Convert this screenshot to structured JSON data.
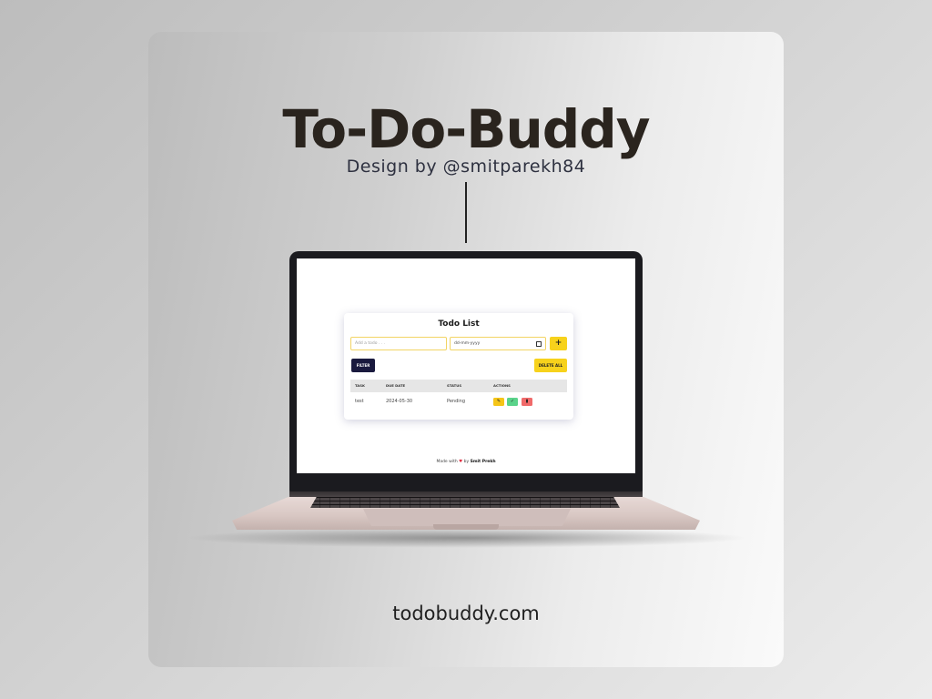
{
  "poster": {
    "title": "To-Do-Buddy",
    "subtitle": "Design by @smitparekh84",
    "domain": "todobuddy.com"
  },
  "app": {
    "title": "Todo List",
    "task_placeholder": "Add a todo . . .",
    "date_placeholder": "dd-mm-yyyy",
    "add_label": "+",
    "filter_label": "FILTER",
    "delete_all_label": "DELETE ALL",
    "table": {
      "headers": [
        "TASK",
        "DUE DATE",
        "STATUS",
        "ACTIONS"
      ],
      "rows": [
        {
          "task": "test",
          "due_date": "2024-05-30",
          "status": "Pending"
        }
      ]
    },
    "footer": {
      "prefix": "Made with",
      "by": "by",
      "author": "Smit Prekh"
    }
  },
  "colors": {
    "accent_yellow": "#f7d21c",
    "filter_navy": "#1a1a3e",
    "title_brown": "#2a241e"
  },
  "icons": [
    "calendar-icon",
    "edit-icon",
    "check-icon",
    "trash-icon",
    "heart-icon"
  ]
}
